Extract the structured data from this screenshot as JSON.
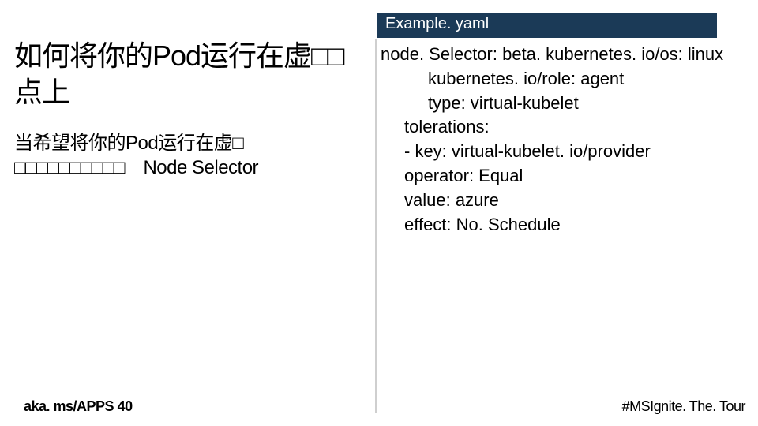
{
  "slide": {
    "title": "如何将你的Pod运行在虚□□点上",
    "body": "当希望将你的Pod运行在虚□\n□□□□□□□□□□ Node Selector"
  },
  "code": {
    "filename": "Example. yaml",
    "lines": [
      {
        "text": "node. Selector:  beta. kubernetes. io/os: linux",
        "indent": 0
      },
      {
        "text": "kubernetes. io/role: agent",
        "indent": 2
      },
      {
        "text": "type: virtual-kubelet",
        "indent": 2
      },
      {
        "text": "tolerations:",
        "indent": 1
      },
      {
        "text": "- key: virtual-kubelet. io/provider",
        "indent": 1
      },
      {
        "text": "  operator: Equal",
        "indent": 1
      },
      {
        "text": "  value: azure",
        "indent": 1
      },
      {
        "text": "  effect: No. Schedule",
        "indent": 1
      }
    ]
  },
  "footer": {
    "left": "aka. ms/APPS 40",
    "right": "#MSIgnite. The. Tour"
  }
}
